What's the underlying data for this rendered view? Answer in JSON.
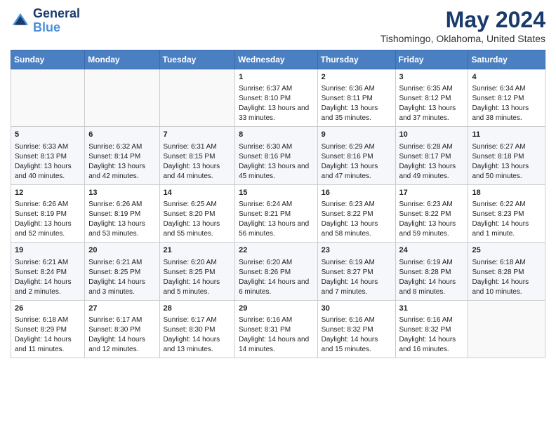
{
  "logo": {
    "line1": "General",
    "line2": "Blue"
  },
  "title": {
    "month_year": "May 2024",
    "location": "Tishomingo, Oklahoma, United States"
  },
  "headers": [
    "Sunday",
    "Monday",
    "Tuesday",
    "Wednesday",
    "Thursday",
    "Friday",
    "Saturday"
  ],
  "weeks": [
    [
      {
        "day": "",
        "info": ""
      },
      {
        "day": "",
        "info": ""
      },
      {
        "day": "",
        "info": ""
      },
      {
        "day": "1",
        "info": "Sunrise: 6:37 AM\nSunset: 8:10 PM\nDaylight: 13 hours and 33 minutes."
      },
      {
        "day": "2",
        "info": "Sunrise: 6:36 AM\nSunset: 8:11 PM\nDaylight: 13 hours and 35 minutes."
      },
      {
        "day": "3",
        "info": "Sunrise: 6:35 AM\nSunset: 8:12 PM\nDaylight: 13 hours and 37 minutes."
      },
      {
        "day": "4",
        "info": "Sunrise: 6:34 AM\nSunset: 8:12 PM\nDaylight: 13 hours and 38 minutes."
      }
    ],
    [
      {
        "day": "5",
        "info": "Sunrise: 6:33 AM\nSunset: 8:13 PM\nDaylight: 13 hours and 40 minutes."
      },
      {
        "day": "6",
        "info": "Sunrise: 6:32 AM\nSunset: 8:14 PM\nDaylight: 13 hours and 42 minutes."
      },
      {
        "day": "7",
        "info": "Sunrise: 6:31 AM\nSunset: 8:15 PM\nDaylight: 13 hours and 44 minutes."
      },
      {
        "day": "8",
        "info": "Sunrise: 6:30 AM\nSunset: 8:16 PM\nDaylight: 13 hours and 45 minutes."
      },
      {
        "day": "9",
        "info": "Sunrise: 6:29 AM\nSunset: 8:16 PM\nDaylight: 13 hours and 47 minutes."
      },
      {
        "day": "10",
        "info": "Sunrise: 6:28 AM\nSunset: 8:17 PM\nDaylight: 13 hours and 49 minutes."
      },
      {
        "day": "11",
        "info": "Sunrise: 6:27 AM\nSunset: 8:18 PM\nDaylight: 13 hours and 50 minutes."
      }
    ],
    [
      {
        "day": "12",
        "info": "Sunrise: 6:26 AM\nSunset: 8:19 PM\nDaylight: 13 hours and 52 minutes."
      },
      {
        "day": "13",
        "info": "Sunrise: 6:26 AM\nSunset: 8:19 PM\nDaylight: 13 hours and 53 minutes."
      },
      {
        "day": "14",
        "info": "Sunrise: 6:25 AM\nSunset: 8:20 PM\nDaylight: 13 hours and 55 minutes."
      },
      {
        "day": "15",
        "info": "Sunrise: 6:24 AM\nSunset: 8:21 PM\nDaylight: 13 hours and 56 minutes."
      },
      {
        "day": "16",
        "info": "Sunrise: 6:23 AM\nSunset: 8:22 PM\nDaylight: 13 hours and 58 minutes."
      },
      {
        "day": "17",
        "info": "Sunrise: 6:23 AM\nSunset: 8:22 PM\nDaylight: 13 hours and 59 minutes."
      },
      {
        "day": "18",
        "info": "Sunrise: 6:22 AM\nSunset: 8:23 PM\nDaylight: 14 hours and 1 minute."
      }
    ],
    [
      {
        "day": "19",
        "info": "Sunrise: 6:21 AM\nSunset: 8:24 PM\nDaylight: 14 hours and 2 minutes."
      },
      {
        "day": "20",
        "info": "Sunrise: 6:21 AM\nSunset: 8:25 PM\nDaylight: 14 hours and 3 minutes."
      },
      {
        "day": "21",
        "info": "Sunrise: 6:20 AM\nSunset: 8:25 PM\nDaylight: 14 hours and 5 minutes."
      },
      {
        "day": "22",
        "info": "Sunrise: 6:20 AM\nSunset: 8:26 PM\nDaylight: 14 hours and 6 minutes."
      },
      {
        "day": "23",
        "info": "Sunrise: 6:19 AM\nSunset: 8:27 PM\nDaylight: 14 hours and 7 minutes."
      },
      {
        "day": "24",
        "info": "Sunrise: 6:19 AM\nSunset: 8:28 PM\nDaylight: 14 hours and 8 minutes."
      },
      {
        "day": "25",
        "info": "Sunrise: 6:18 AM\nSunset: 8:28 PM\nDaylight: 14 hours and 10 minutes."
      }
    ],
    [
      {
        "day": "26",
        "info": "Sunrise: 6:18 AM\nSunset: 8:29 PM\nDaylight: 14 hours and 11 minutes."
      },
      {
        "day": "27",
        "info": "Sunrise: 6:17 AM\nSunset: 8:30 PM\nDaylight: 14 hours and 12 minutes."
      },
      {
        "day": "28",
        "info": "Sunrise: 6:17 AM\nSunset: 8:30 PM\nDaylight: 14 hours and 13 minutes."
      },
      {
        "day": "29",
        "info": "Sunrise: 6:16 AM\nSunset: 8:31 PM\nDaylight: 14 hours and 14 minutes."
      },
      {
        "day": "30",
        "info": "Sunrise: 6:16 AM\nSunset: 8:32 PM\nDaylight: 14 hours and 15 minutes."
      },
      {
        "day": "31",
        "info": "Sunrise: 6:16 AM\nSunset: 8:32 PM\nDaylight: 14 hours and 16 minutes."
      },
      {
        "day": "",
        "info": ""
      }
    ]
  ]
}
